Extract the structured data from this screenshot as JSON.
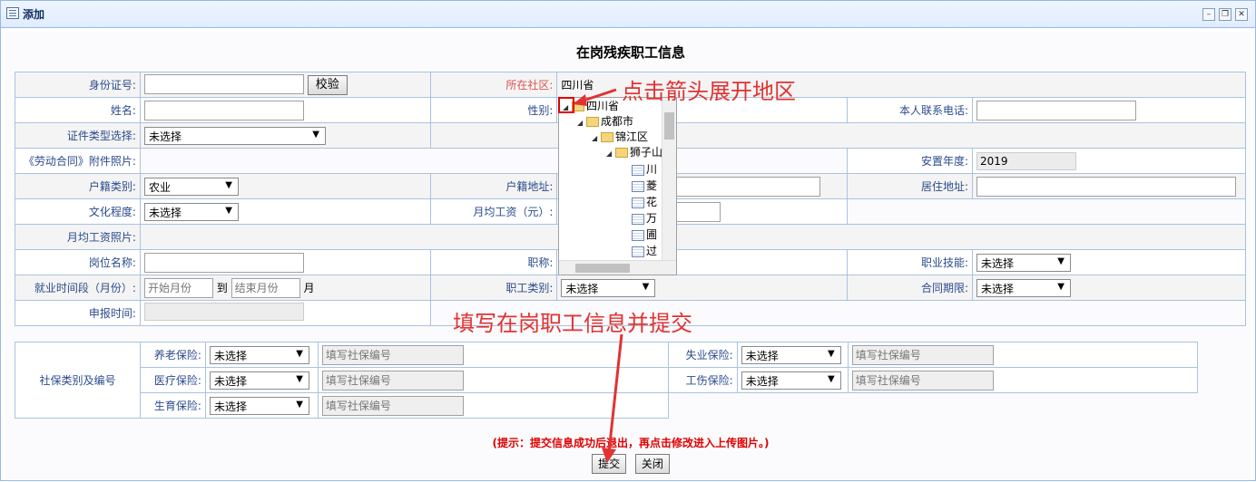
{
  "window": {
    "title": "添加"
  },
  "form": {
    "title": "在岗残疾职工信息",
    "id_label": "身份证号:",
    "verify_button": "校验",
    "community_label": "所在社区:",
    "community_value": "四川省",
    "name_label": "姓名:",
    "gender_label": "性别:",
    "phone_label": "本人联系电话:",
    "id_type_label": "证件类型选择:",
    "id_type_value": "未选择",
    "contract_photo_label": "《劳动合同》附件照片:",
    "placement_year_label": "安置年度:",
    "placement_year_value": "2019",
    "household_type_label": "户籍类别:",
    "household_type_value": "农业",
    "household_addr_label": "户籍地址:",
    "residence_addr_label": "居住地址:",
    "education_label": "文化程度:",
    "education_value": "未选择",
    "monthly_wage_label": "月均工资（元）:",
    "wage_photo_label": "月均工资照片:",
    "position_label": "岗位名称:",
    "title_label": "职称:",
    "skill_label": "职业技能:",
    "skill_value": "未选择",
    "period_label": "就业时间段（月份）:",
    "start_placeholder": "开始月份",
    "to_text": "到",
    "end_placeholder": "结束月份",
    "month_text": "月",
    "worker_type_label": "职工类别:",
    "worker_type_value": "未选择",
    "contract_term_label": "合同期限:",
    "contract_term_value": "未选择",
    "report_time_label": "申报时间:"
  },
  "insurance": {
    "section_label": "社保类别及编号",
    "placeholder": "填写社保编号",
    "pension_label": "养老保险:",
    "pension_value": "未选择",
    "unemployment_label": "失业保险:",
    "unemployment_value": "未选择",
    "medical_label": "医疗保险:",
    "medical_value": "未选择",
    "injury_label": "工伤保险:",
    "injury_value": "未选择",
    "maternity_label": "生育保险:",
    "maternity_value": "未选择"
  },
  "tree": {
    "items": [
      "四川省",
      "成都市",
      "锦江区",
      "狮子山",
      "川",
      "菱",
      "花",
      "万",
      "圃",
      "过"
    ]
  },
  "annotations": {
    "expand_hint": "点击箭头展开地区",
    "submit_hint": "填写在岗职工信息并提交"
  },
  "footer": {
    "hint": "(提示：提交信息成功后退出，再点击修改进入上传图片。)",
    "submit_button": "提交",
    "close_button": "关闭"
  },
  "colors": {
    "annotation": "#e23232",
    "label": "#2b4b8c",
    "border": "#a8c3e0"
  }
}
